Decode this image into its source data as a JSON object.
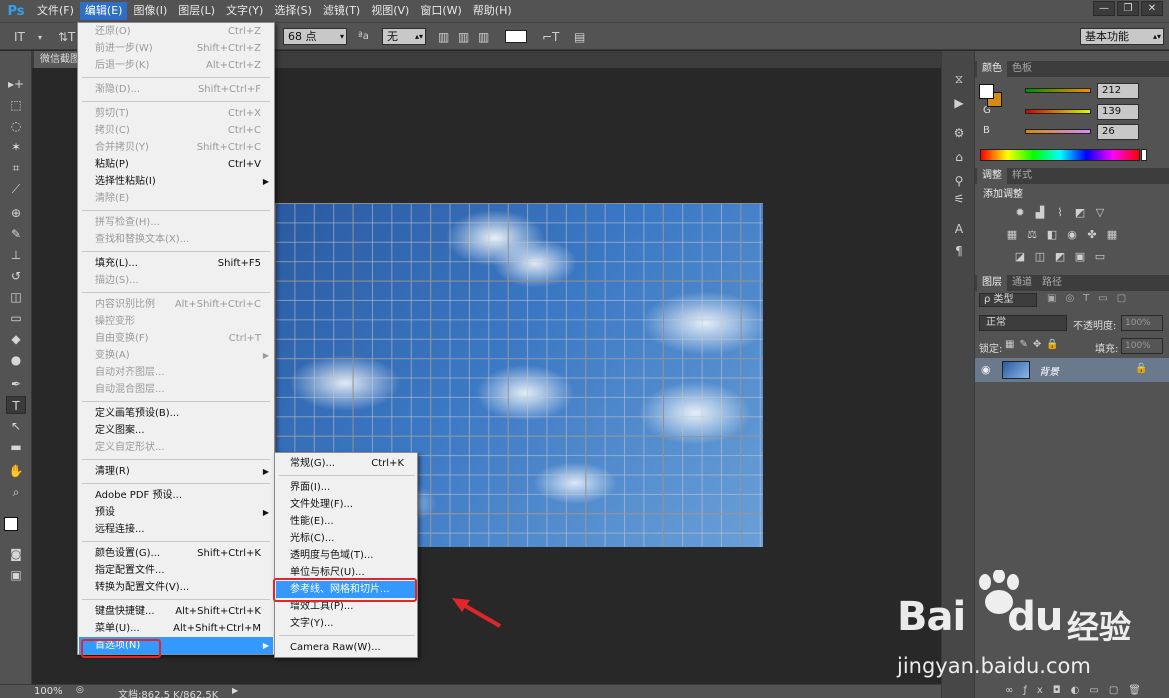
{
  "app": {
    "logo": "Ps"
  },
  "menubar": {
    "items": [
      "文件(F)",
      "编辑(E)",
      "图像(I)",
      "图层(L)",
      "文字(Y)",
      "选择(S)",
      "滤镜(T)",
      "视图(V)",
      "窗口(W)",
      "帮助(H)"
    ],
    "active_index": 1
  },
  "window_controls": [
    "—",
    "❐",
    "✕"
  ],
  "options_bar": {
    "font_size": "68 点",
    "antialias_icon_label": "ªa",
    "antialias": "无",
    "workspace": "基本功能"
  },
  "document_tab": {
    "title": "微信截图"
  },
  "status_bar": {
    "zoom": "100%",
    "doc_info": "文档:862.5 K/862.5K"
  },
  "edit_menu": {
    "items": [
      {
        "label": "还原(O)",
        "shortcut": "Ctrl+Z",
        "disabled": true
      },
      {
        "label": "前进一步(W)",
        "shortcut": "Shift+Ctrl+Z",
        "disabled": true
      },
      {
        "label": "后退一步(K)",
        "shortcut": "Alt+Ctrl+Z",
        "disabled": true
      },
      {
        "sep": true
      },
      {
        "label": "渐隐(D)...",
        "shortcut": "Shift+Ctrl+F",
        "disabled": true
      },
      {
        "sep": true
      },
      {
        "label": "剪切(T)",
        "shortcut": "Ctrl+X",
        "disabled": true
      },
      {
        "label": "拷贝(C)",
        "shortcut": "Ctrl+C",
        "disabled": true
      },
      {
        "label": "合并拷贝(Y)",
        "shortcut": "Shift+Ctrl+C",
        "disabled": true
      },
      {
        "label": "粘贴(P)",
        "shortcut": "Ctrl+V",
        "disabled": false
      },
      {
        "label": "选择性粘贴(I)",
        "shortcut": "",
        "disabled": false,
        "submenu": true
      },
      {
        "label": "清除(E)",
        "shortcut": "",
        "disabled": true
      },
      {
        "sep": true
      },
      {
        "label": "拼写检查(H)...",
        "shortcut": "",
        "disabled": true
      },
      {
        "label": "查找和替换文本(X)...",
        "shortcut": "",
        "disabled": true
      },
      {
        "sep": true
      },
      {
        "label": "填充(L)...",
        "shortcut": "Shift+F5",
        "disabled": false
      },
      {
        "label": "描边(S)...",
        "shortcut": "",
        "disabled": true
      },
      {
        "sep": true
      },
      {
        "label": "内容识别比例",
        "shortcut": "Alt+Shift+Ctrl+C",
        "disabled": true
      },
      {
        "label": "操控变形",
        "shortcut": "",
        "disabled": true
      },
      {
        "label": "自由变换(F)",
        "shortcut": "Ctrl+T",
        "disabled": true
      },
      {
        "label": "变换(A)",
        "shortcut": "",
        "disabled": true,
        "submenu": true
      },
      {
        "label": "自动对齐图层...",
        "shortcut": "",
        "disabled": true
      },
      {
        "label": "自动混合图层...",
        "shortcut": "",
        "disabled": true
      },
      {
        "sep": true
      },
      {
        "label": "定义画笔预设(B)...",
        "shortcut": "",
        "disabled": false
      },
      {
        "label": "定义图案...",
        "shortcut": "",
        "disabled": false
      },
      {
        "label": "定义自定形状...",
        "shortcut": "",
        "disabled": true
      },
      {
        "sep": true
      },
      {
        "label": "清理(R)",
        "shortcut": "",
        "disabled": false,
        "submenu": true
      },
      {
        "sep": true
      },
      {
        "label": "Adobe PDF 预设...",
        "shortcut": "",
        "disabled": false
      },
      {
        "label": "预设",
        "shortcut": "",
        "disabled": false,
        "submenu": true
      },
      {
        "label": "远程连接...",
        "shortcut": "",
        "disabled": false
      },
      {
        "sep": true
      },
      {
        "label": "颜色设置(G)...",
        "shortcut": "Shift+Ctrl+K",
        "disabled": false
      },
      {
        "label": "指定配置文件...",
        "shortcut": "",
        "disabled": false
      },
      {
        "label": "转换为配置文件(V)...",
        "shortcut": "",
        "disabled": false
      },
      {
        "sep": true
      },
      {
        "label": "键盘快捷键...",
        "shortcut": "Alt+Shift+Ctrl+K",
        "disabled": false
      },
      {
        "label": "菜单(U)...",
        "shortcut": "Alt+Shift+Ctrl+M",
        "disabled": false
      },
      {
        "label": "首选项(N)",
        "shortcut": "",
        "disabled": false,
        "submenu": true,
        "highlight": true
      }
    ]
  },
  "pref_menu": {
    "items": [
      {
        "label": "常规(G)...",
        "shortcut": "Ctrl+K"
      },
      {
        "sep": true
      },
      {
        "label": "界面(I)...",
        "shortcut": ""
      },
      {
        "label": "文件处理(F)...",
        "shortcut": ""
      },
      {
        "label": "性能(E)...",
        "shortcut": ""
      },
      {
        "label": "光标(C)...",
        "shortcut": ""
      },
      {
        "label": "透明度与色域(T)...",
        "shortcut": ""
      },
      {
        "label": "单位与标尺(U)...",
        "shortcut": ""
      },
      {
        "label": "参考线、网格和切片...",
        "shortcut": "",
        "highlight": true
      },
      {
        "label": "增效工具(P)...",
        "shortcut": ""
      },
      {
        "label": "文字(Y)...",
        "shortcut": ""
      },
      {
        "sep": true
      },
      {
        "label": "Camera Raw(W)...",
        "shortcut": ""
      }
    ]
  },
  "color_panel": {
    "tabs": [
      "颜色",
      "色板"
    ],
    "channels": [
      {
        "label": "R",
        "value": "212"
      },
      {
        "label": "G",
        "value": "139"
      },
      {
        "label": "B",
        "value": "26"
      }
    ],
    "foreground": "#ffffff",
    "background": "#d48b1a"
  },
  "adjust_panel": {
    "tabs": [
      "调整",
      "样式"
    ],
    "title": "添加调整"
  },
  "layers_panel": {
    "tabs": [
      "图层",
      "通道",
      "路径"
    ],
    "filter": "ρ 类型",
    "blend_mode": "正常",
    "opacity_label": "不透明度:",
    "opacity": "100%",
    "lock_label": "锁定:",
    "fill_label": "填充:",
    "fill": "100%",
    "layer_name": "背景"
  },
  "watermark": {
    "brand": "Bai",
    "brand_suffix": "du",
    "cn": "经验",
    "url": "jingyan.baidu.com"
  },
  "colors": {
    "accent": "#3399ff",
    "menubar": "#535353",
    "highlight_box": "#e0262b",
    "ps_blue": "#2fa3f0"
  }
}
